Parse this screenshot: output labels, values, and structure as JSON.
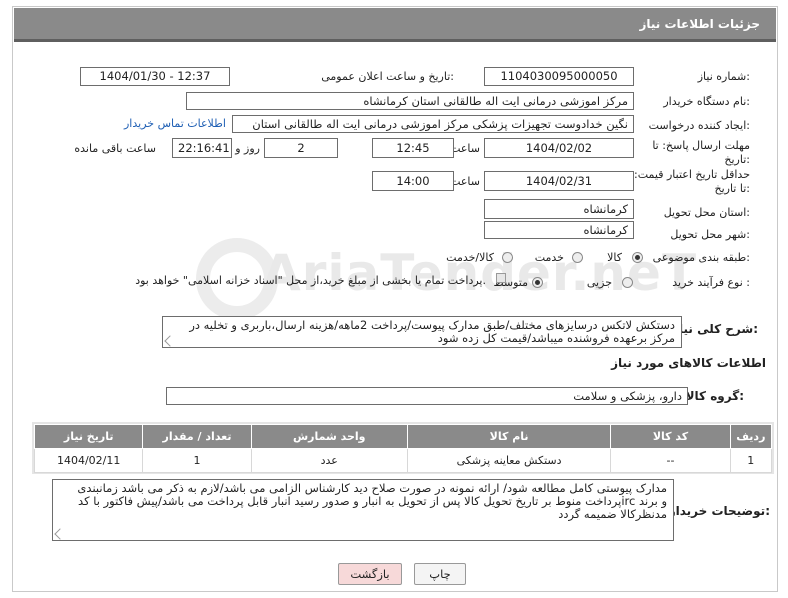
{
  "header": {
    "title": "جزئیات اطلاعات نیاز"
  },
  "fields": {
    "need_number_label": "شماره نیاز:",
    "need_number": "1104030095000050",
    "announce_label": "تاریخ و ساعت اعلان عمومی:",
    "announce_value": "1404/01/30 - 12:37",
    "buyer_label": "نام دستگاه خریدار:",
    "buyer_value": "مرکز اموزشی درمانی ایت اله طالقانی استان کرمانشاه",
    "creator_label": "ایجاد کننده درخواست:",
    "creator_value": "نگین خدادوست تجهیزات پزشکی مرکز اموزشی درمانی ایت اله طالقانی استان",
    "contact_link": "اطلاعات تماس خریدار",
    "deadline_label": "مهلت ارسال پاسخ: تا تاریخ:",
    "deadline_date": "1404/02/02",
    "time_word": "ساعت",
    "deadline_time": "12:45",
    "days_value": "2",
    "days_word": "روز و",
    "remaining_time": "22:16:41",
    "remaining_label": "ساعت باقی مانده",
    "validity_label": "حداقل تاریخ اعتبار قیمت: تا تاریخ:",
    "validity_date": "1404/02/31",
    "validity_time_word": "ساعت",
    "validity_time": "14:00",
    "province_label": "استان محل تحویل:",
    "province_value": "کرمانشاه",
    "city_label": "شهر محل تحویل:",
    "city_value": "کرمانشاه",
    "category_label": "طبقه بندی موضوعی:",
    "category_options": [
      "کالا",
      "خدمت",
      "کالا/خدمت"
    ],
    "process_label": "نوع فرآیند خرید :",
    "process_options": [
      "جزیی",
      "متوسط"
    ],
    "payment_note": "پرداخت تمام یا بخشی از مبلغ خرید،از محل \"اسناد خزانه اسلامی\" خواهد بود."
  },
  "description": {
    "label": "شرح کلی نیاز:",
    "text": "دستکش لاتکس درسایزهای مختلف/طبق مدارک پیوست/پرداخت 2ماهه/هزینه ارسال،باربری و تخلیه در مرکز برعهده فروشنده میباشد/قیمت کل زده شود"
  },
  "goods": {
    "section_title": "اطلاعات کالاهای مورد نیاز",
    "group_label": "گروه کالا:",
    "group_value": "دارو، پزشکی و سلامت",
    "columns": [
      "ردیف",
      "کد کالا",
      "نام کالا",
      "واحد شمارش",
      "تعداد / مقدار",
      "تاریخ نیاز"
    ],
    "rows": [
      {
        "row": "1",
        "code": "--",
        "name": "دستکش معاینه پزشکی",
        "unit": "عدد",
        "qty": "1",
        "date": "1404/02/11"
      }
    ]
  },
  "buyer_notes": {
    "label": "توضیحات خریدار:",
    "text": "مدارک پیوستی کامل مطالعه شود/ ارائه نمونه در صورت صلاح دید کارشناس الزامی می باشد/لازم به ذکر می باشد زمانبندی پرداخت منوط بر تاریخ تحویل کالا  پس از تحویل به انبار و صدور رسید انبار قابل پرداخت می باشد/پیش فاکتور با کدirc و برند مدنظرکالا ضمیمه گردد"
  },
  "buttons": {
    "print": "چاپ",
    "back": "بازگشت"
  },
  "watermark": {
    "text": "AriaTender.neT"
  },
  "colors": {
    "header_bg": "#8a8a8a",
    "link": "#1f5fb4",
    "back_button_bg": "#f7d9d9"
  }
}
